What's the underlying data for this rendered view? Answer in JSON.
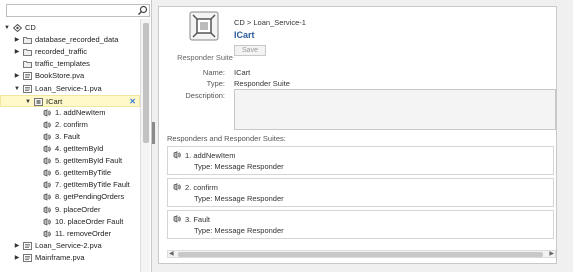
{
  "search": {
    "placeholder": ""
  },
  "tree": [
    {
      "label": "CD",
      "indent": 0,
      "twisty": "down",
      "icon": "workspace-icon"
    },
    {
      "label": "database_recorded_data",
      "indent": 1,
      "twisty": "right",
      "icon": "folder-icon"
    },
    {
      "label": "recorded_traffic",
      "indent": 1,
      "twisty": "right",
      "icon": "folder-icon"
    },
    {
      "label": "traffic_templates",
      "indent": 1,
      "twisty": "none",
      "icon": "folder-icon"
    },
    {
      "label": "BookStore.pva",
      "indent": 1,
      "twisty": "right",
      "icon": "pva-icon"
    },
    {
      "label": "Loan_Service-1.pva",
      "indent": 1,
      "twisty": "down",
      "icon": "pva-icon"
    },
    {
      "label": "ICart",
      "indent": 2,
      "twisty": "down",
      "icon": "suite-icon",
      "selected": true
    },
    {
      "label": "1. addNewItem",
      "indent": 3,
      "twisty": "none",
      "icon": "responder-icon"
    },
    {
      "label": "2. confirm",
      "indent": 3,
      "twisty": "none",
      "icon": "responder-icon"
    },
    {
      "label": "3. Fault",
      "indent": 3,
      "twisty": "none",
      "icon": "responder-icon"
    },
    {
      "label": "4. getItemById",
      "indent": 3,
      "twisty": "none",
      "icon": "responder-icon"
    },
    {
      "label": "5. getItemById Fault",
      "indent": 3,
      "twisty": "none",
      "icon": "responder-icon"
    },
    {
      "label": "6. getItemByTitle",
      "indent": 3,
      "twisty": "none",
      "icon": "responder-icon"
    },
    {
      "label": "7. getItemByTitle Fault",
      "indent": 3,
      "twisty": "none",
      "icon": "responder-icon"
    },
    {
      "label": "8. getPendingOrders",
      "indent": 3,
      "twisty": "none",
      "icon": "responder-icon"
    },
    {
      "label": "9. placeOrder",
      "indent": 3,
      "twisty": "none",
      "icon": "responder-icon"
    },
    {
      "label": "10. placeOrder Fault",
      "indent": 3,
      "twisty": "none",
      "icon": "responder-icon"
    },
    {
      "label": "11. removeOrder",
      "indent": 3,
      "twisty": "none",
      "icon": "responder-icon"
    },
    {
      "label": "Loan_Service-2.pva",
      "indent": 1,
      "twisty": "right",
      "icon": "pva-icon"
    },
    {
      "label": "Mainframe.pva",
      "indent": 1,
      "twisty": "right",
      "icon": "pva-icon"
    }
  ],
  "detail": {
    "suite_caption": "Responder Suite",
    "breadcrumb": "CD > Loan_Service-1",
    "title": "ICart",
    "save_label": "Save",
    "name_label": "Name:",
    "name_value": "ICart",
    "type_label": "Type:",
    "type_value": "Responder Suite",
    "description_label": "Description:",
    "description_value": "",
    "section_title": "Responders and Responder Suites:",
    "responders": [
      {
        "name": "1. addNewItem",
        "type": "Type: Message Responder"
      },
      {
        "name": "2. confirm",
        "type": "Type: Message Responder"
      },
      {
        "name": "3. Fault",
        "type": "Type: Message Responder"
      }
    ]
  },
  "colors": {
    "accent": "#2a5c9a",
    "selection": "#fff8c8",
    "link_x": "#3a7bd5"
  }
}
